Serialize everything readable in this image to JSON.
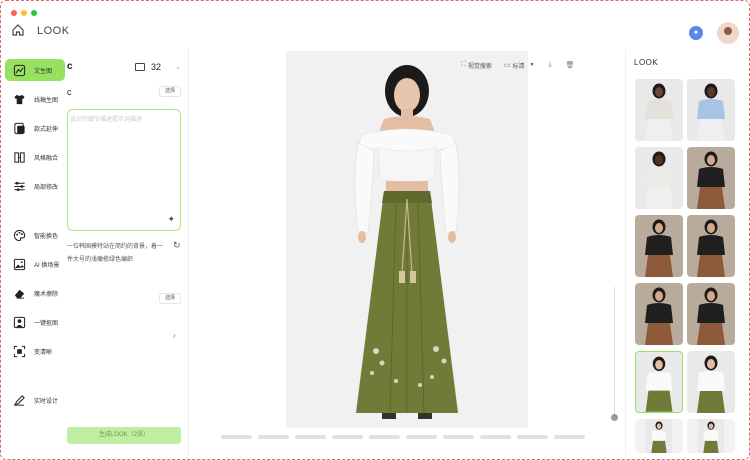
{
  "app": {
    "title": "LOOK"
  },
  "colors": {
    "accent": "#97e060",
    "accent_light": "#bfeea0",
    "skirt": "#6f7b36",
    "border_dash": "#e06a6a"
  },
  "nav": {
    "items": [
      {
        "label": "文生图",
        "icon": "text-image-icon",
        "active": true
      },
      {
        "label": "线稿生图",
        "icon": "shirt-icon",
        "active": false
      },
      {
        "label": "款式延伸",
        "icon": "style-extend-icon",
        "active": false
      },
      {
        "label": "风格融合",
        "icon": "blend-icon",
        "active": false
      },
      {
        "label": "局部修改",
        "icon": "sliders-icon",
        "active": false
      },
      {
        "label": "智能换色",
        "icon": "palette-icon",
        "active": false
      },
      {
        "label": "AI 换场景",
        "icon": "scene-icon",
        "active": false
      },
      {
        "label": "魔术擦除",
        "icon": "eraser-icon",
        "active": false
      },
      {
        "label": "一键抠图",
        "icon": "cutout-icon",
        "active": false
      },
      {
        "label": "变清晰",
        "icon": "sharpen-icon",
        "active": false
      },
      {
        "label": "实时设计",
        "icon": "live-design-icon",
        "active": false
      }
    ]
  },
  "panel": {
    "heading_fragment": "c",
    "count": "32",
    "sub_fragment": "c",
    "select_label": "选择",
    "select_label_2": "选择",
    "prompt_placeholder": "设计的细节描述提示词描述",
    "example_text": "一位韩国模特站在简约的背景，着一件大号的浅橄榄绿色编织",
    "generate_label": "生成LOOK（2张）"
  },
  "toolbar": {
    "visual_search": "视觉搜索",
    "quality": "标清"
  },
  "right": {
    "title": "LOOK"
  },
  "thumbnails": [
    {
      "kind": "sweater",
      "selected": false
    },
    {
      "kind": "sweater-blue",
      "selected": false
    },
    {
      "kind": "sweater-white",
      "selected": false
    },
    {
      "kind": "street",
      "selected": false
    },
    {
      "kind": "street",
      "selected": false
    },
    {
      "kind": "street",
      "selected": false
    },
    {
      "kind": "street",
      "selected": false
    },
    {
      "kind": "street",
      "selected": false
    },
    {
      "kind": "green-skirt",
      "selected": true
    },
    {
      "kind": "green-skirt",
      "selected": false
    },
    {
      "kind": "green-skirt",
      "selected": false
    },
    {
      "kind": "green-skirt",
      "selected": false
    }
  ],
  "pager": {
    "pages": 10
  }
}
